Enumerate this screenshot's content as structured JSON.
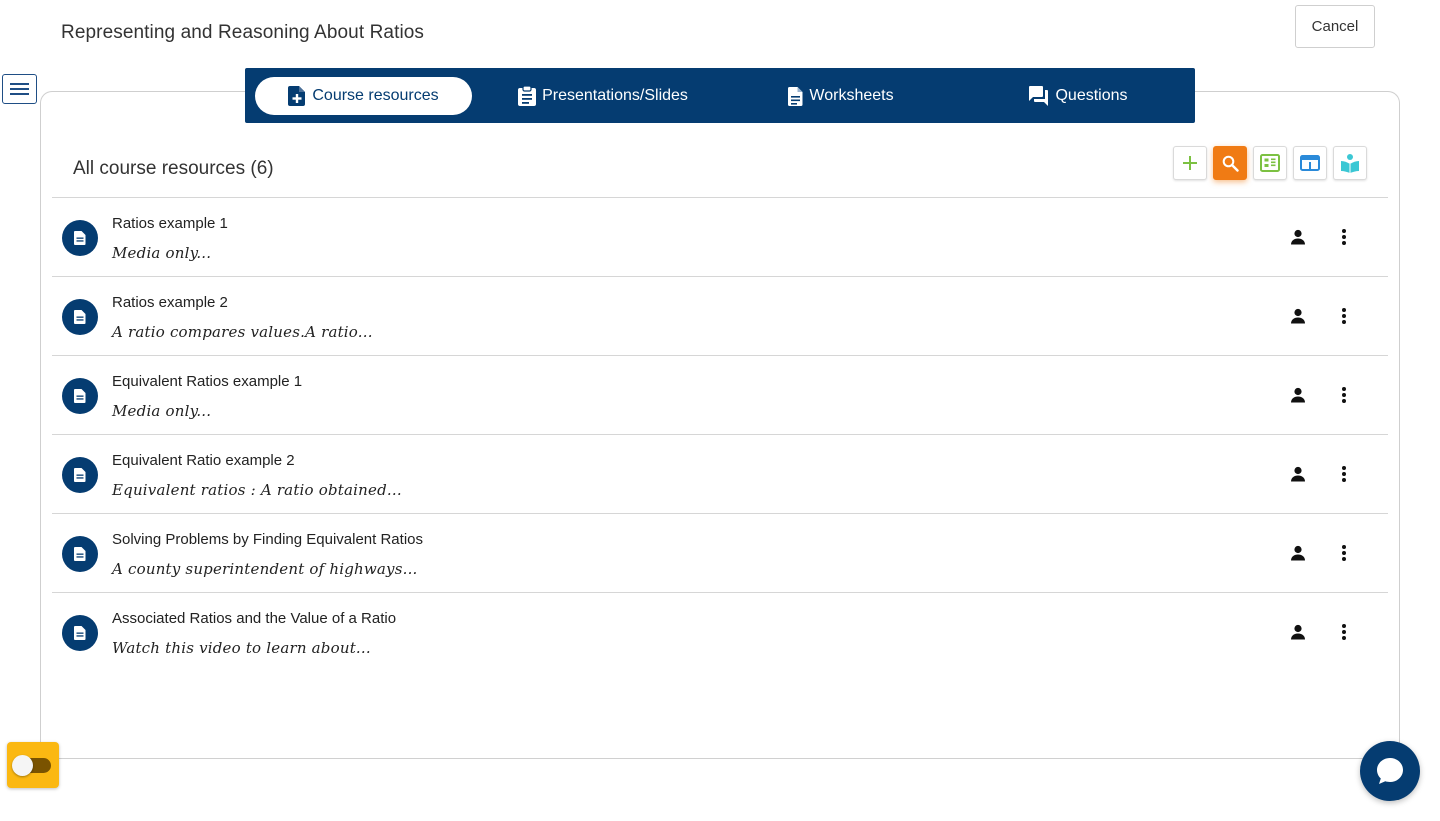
{
  "header": {
    "title": "Representing and Reasoning About Ratios",
    "cancel_label": "Cancel"
  },
  "tabs": [
    {
      "label": "Course resources",
      "icon": "note-add-icon",
      "active": true
    },
    {
      "label": "Presentations/Slides",
      "icon": "clipboard-icon",
      "active": false
    },
    {
      "label": "Worksheets",
      "icon": "document-icon",
      "active": false
    },
    {
      "label": "Questions",
      "icon": "forum-icon",
      "active": false
    }
  ],
  "section": {
    "title": "All course resources (6)"
  },
  "toolbar": [
    {
      "name": "add-button",
      "icon": "plus-icon",
      "color": "#7cc142"
    },
    {
      "name": "search-button",
      "icon": "search-icon",
      "color": "#f07b14"
    },
    {
      "name": "resource-grid-button",
      "icon": "grid-icon",
      "color": "#7cc142"
    },
    {
      "name": "browser-button",
      "icon": "browser-icon",
      "color": "#2a8ad9"
    },
    {
      "name": "reader-button",
      "icon": "reader-icon",
      "color": "#3bc7d4"
    }
  ],
  "resources": [
    {
      "title": "Ratios example 1",
      "description": "Media only..."
    },
    {
      "title": "Ratios example 2",
      "description": "A ratio compares values.A ratio..."
    },
    {
      "title": "Equivalent Ratios example 1",
      "description": "Media only..."
    },
    {
      "title": "Equivalent Ratio example 2",
      "description": "Equivalent ratios : A ratio obtained..."
    },
    {
      "title": "Solving Problems by Finding Equivalent Ratios",
      "description": "A county superintendent of highways..."
    },
    {
      "title": "Associated Ratios and the Value of a Ratio",
      "description": "Watch this video to learn about..."
    }
  ],
  "colors": {
    "primary": "#053c71",
    "accent": "#f07b14",
    "toggle": "#fbb812"
  }
}
